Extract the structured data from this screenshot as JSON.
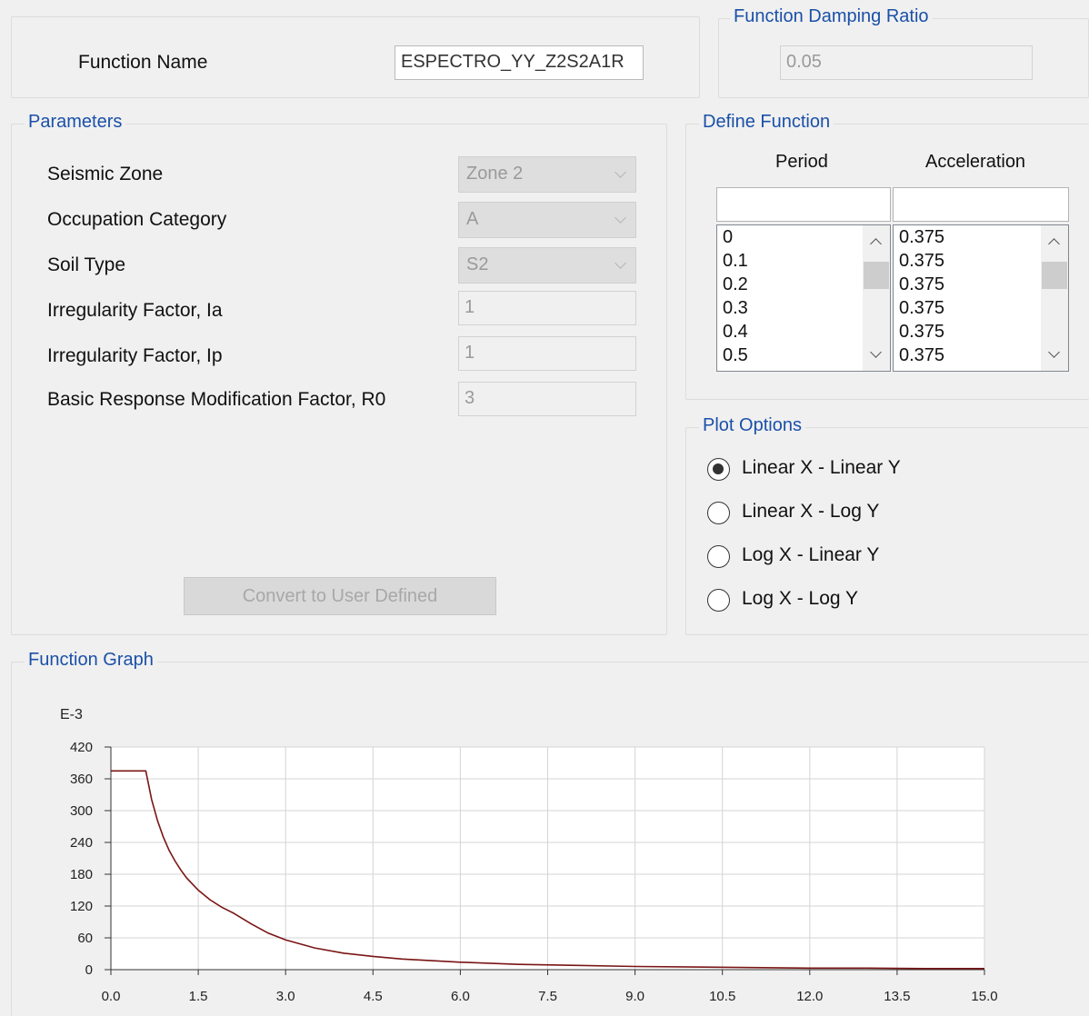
{
  "function_name": {
    "label": "Function Name",
    "value": "ESPECTRO_YY_Z2S2A1R"
  },
  "damping": {
    "title": "Function Damping Ratio",
    "value": "0.05"
  },
  "parameters": {
    "title": "Parameters",
    "seismic_zone": {
      "label": "Seismic Zone",
      "value": "Zone 2"
    },
    "occupation_category": {
      "label": "Occupation Category",
      "value": "A"
    },
    "soil_type": {
      "label": "Soil Type",
      "value": "S2"
    },
    "irregularity_ia": {
      "label": "Irregularity Factor, Ia",
      "value": "1"
    },
    "irregularity_ip": {
      "label": "Irregularity Factor, Ip",
      "value": "1"
    },
    "r0": {
      "label": "Basic Response Modification Factor, R0",
      "value": "3"
    },
    "convert_button": "Convert to User Defined"
  },
  "define_function": {
    "title": "Define Function",
    "period_header": "Period",
    "acceleration_header": "Acceleration",
    "periods": [
      "0",
      "0.1",
      "0.2",
      "0.3",
      "0.4",
      "0.5"
    ],
    "accelerations": [
      "0.375",
      "0.375",
      "0.375",
      "0.375",
      "0.375",
      "0.375"
    ]
  },
  "plot_options": {
    "title": "Plot Options",
    "options": [
      "Linear X - Linear Y",
      "Linear X - Log Y",
      "Log X - Linear Y",
      "Log X - Log Y"
    ],
    "selected": 0
  },
  "graph": {
    "title": "Function Graph",
    "y_multiplier": "E-3"
  },
  "colors": {
    "accent_title": "#1a50a8",
    "curve": "#7a1515"
  },
  "chart_data": {
    "type": "line",
    "x": [
      0,
      0.1,
      0.2,
      0.3,
      0.4,
      0.5,
      0.6,
      0.7,
      0.8,
      0.9,
      1.0,
      1.1,
      1.2,
      1.3,
      1.5,
      1.7,
      1.9,
      2.1,
      2.4,
      2.7,
      3.0,
      3.5,
      4.0,
      4.5,
      5.0,
      5.5,
      6.0,
      7.0,
      8.0,
      9.0,
      10.0,
      11.0,
      12.0,
      13.0,
      14.0,
      15.0
    ],
    "y": [
      375,
      375,
      375,
      375,
      375,
      375,
      375,
      321,
      281,
      250,
      225,
      205,
      188,
      173,
      150,
      132,
      118,
      107,
      87,
      69,
      56,
      41,
      31,
      25,
      20,
      17,
      14,
      10,
      8,
      6,
      5,
      4,
      3,
      3,
      2,
      2
    ],
    "xlim": [
      0,
      15
    ],
    "ylim": [
      0,
      420
    ],
    "xticks": [
      "0.0",
      "1.5",
      "3.0",
      "4.5",
      "6.0",
      "7.5",
      "9.0",
      "10.5",
      "12.0",
      "13.5",
      "15.0"
    ],
    "yticks": [
      "0",
      "60",
      "120",
      "180",
      "240",
      "300",
      "360",
      "420"
    ],
    "grid": true
  }
}
